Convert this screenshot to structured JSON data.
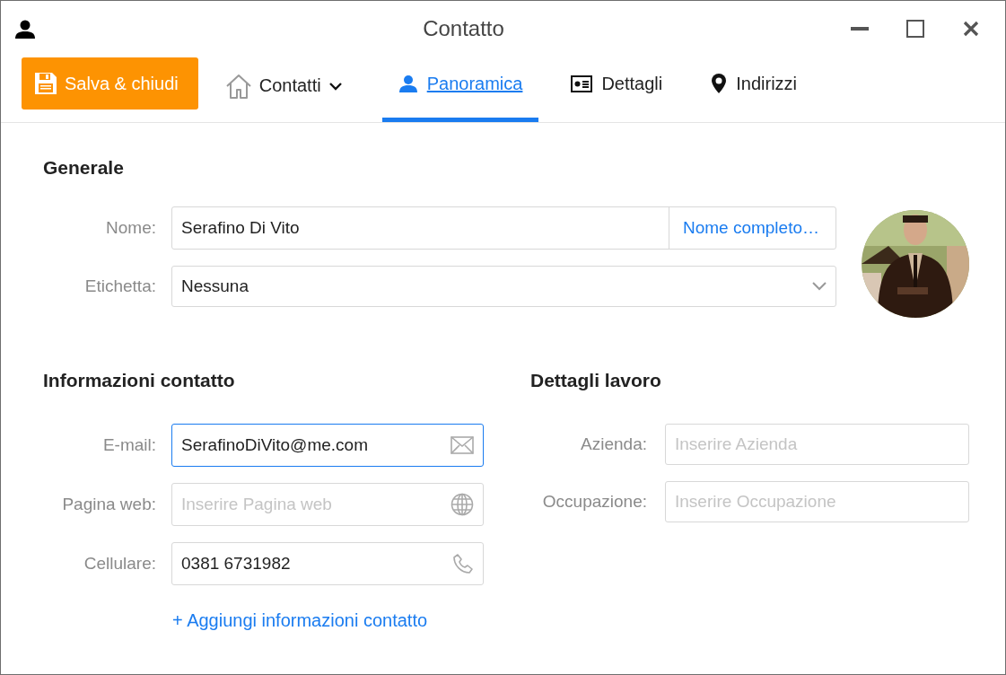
{
  "window": {
    "title": "Contatto"
  },
  "toolbar": {
    "save_button": "Salva & chiudi",
    "contacts_menu": "Contatti",
    "tabs": [
      {
        "label": "Panoramica",
        "selected": true
      },
      {
        "label": "Dettagli",
        "selected": false
      },
      {
        "label": "Indirizzi",
        "selected": false
      }
    ]
  },
  "general": {
    "heading": "Generale",
    "fields": [
      {
        "kind": "name",
        "label": "Nome:",
        "value": "Serafino Di Vito",
        "action": "Nome completo…"
      },
      {
        "kind": "select",
        "label": "Etichetta:",
        "value": "Nessuna"
      }
    ]
  },
  "contact_info": {
    "heading": "Informazioni contatto",
    "fields": [
      {
        "label": "E-mail:",
        "value": "SerafinoDiVito@me.com",
        "focused": true
      },
      {
        "label": "Pagina web:",
        "placeholder": "Inserire Pagina web",
        "focused": false
      },
      {
        "label": "Cellulare:",
        "value": "0381 6731982",
        "focused": false
      }
    ],
    "add_link": "+ Aggiungi informazioni contatto"
  },
  "work_details": {
    "heading": "Dettagli lavoro",
    "fields": [
      {
        "label": "Azienda:",
        "placeholder": "Inserire Azienda",
        "focused": false
      },
      {
        "label": "Occupazione:",
        "placeholder": "Inserire Occupazione",
        "focused": false
      }
    ]
  }
}
